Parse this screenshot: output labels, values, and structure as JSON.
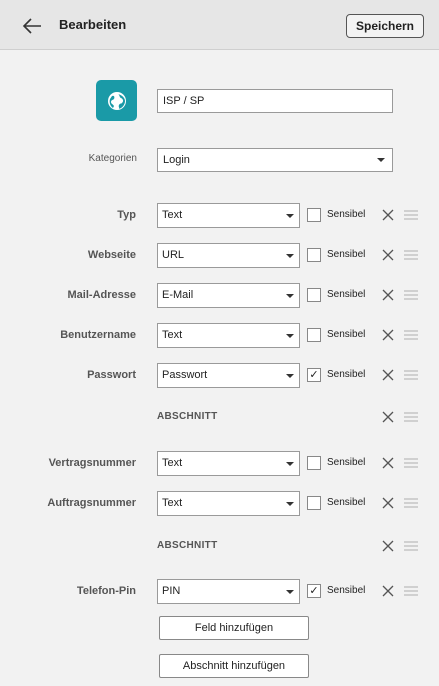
{
  "header": {
    "title": "Bearbeiten",
    "save_label": "Speichern"
  },
  "entry": {
    "icon": "globe-icon",
    "icon_bg": "#1a9aa7",
    "name": "ISP / SP"
  },
  "category": {
    "label": "Kategorien",
    "value": "Login"
  },
  "fields": [
    {
      "kind": "field",
      "label": "Typ",
      "type": "Text",
      "sensitive_label": "Sensibel",
      "sensitive": false
    },
    {
      "kind": "field",
      "label": "Webseite",
      "type": "URL",
      "sensitive_label": "Sensibel",
      "sensitive": false
    },
    {
      "kind": "field",
      "label": "Mail-Adresse",
      "type": "E-Mail",
      "sensitive_label": "Sensibel",
      "sensitive": false
    },
    {
      "kind": "field",
      "label": "Benutzername",
      "type": "Text",
      "sensitive_label": "Sensibel",
      "sensitive": false
    },
    {
      "kind": "field",
      "label": "Passwort",
      "type": "Passwort",
      "sensitive_label": "Sensibel",
      "sensitive": true
    },
    {
      "kind": "section",
      "label": "ABSCHNITT"
    },
    {
      "kind": "field",
      "label": "Vertragsnummer",
      "type": "Text",
      "sensitive_label": "Sensibel",
      "sensitive": false
    },
    {
      "kind": "field",
      "label": "Auftragsnummer",
      "type": "Text",
      "sensitive_label": "Sensibel",
      "sensitive": false
    },
    {
      "kind": "section",
      "label": "ABSCHNITT"
    },
    {
      "kind": "field",
      "label": "Telefon-Pin",
      "type": "PIN",
      "sensitive_label": "Sensibel",
      "sensitive": true
    }
  ],
  "actions": {
    "add_field": "Feld hinzufügen",
    "add_section": "Abschnitt hinzufügen"
  },
  "checkmark": "✓"
}
